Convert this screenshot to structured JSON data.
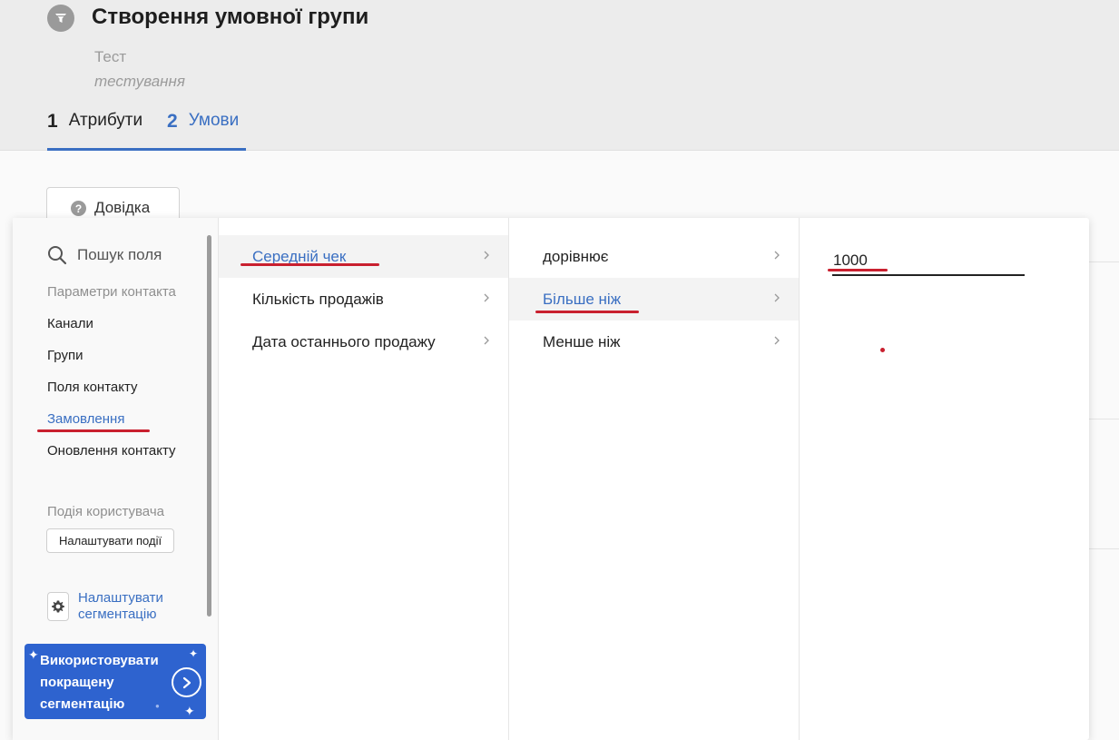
{
  "header": {
    "title": "Створення умовної групи",
    "subtitle": "Тест",
    "description": "тестування",
    "icon": "funnel-icon",
    "steps": [
      {
        "number": "1",
        "label": "Атрибути"
      },
      {
        "number": "2",
        "label": "Умови"
      }
    ]
  },
  "help_button": {
    "label": "Довідка",
    "icon": "help-circle-icon"
  },
  "fields_menu": {
    "search_placeholder": "Пошук поля",
    "contact_section_label": "Параметри контакта",
    "items": [
      "Канали",
      "Групи",
      "Поля контакту",
      "Замовлення",
      "Оновлення контакту"
    ],
    "active_item": "Замовлення",
    "events_section_label": "Подія користувача",
    "configure_events_label": "Налаштувати події",
    "configure_segmentation_label": "Налаштувати сегментацію",
    "promo_label": "Використовувати покращену сегментацію"
  },
  "order_fields": {
    "items": [
      "Середній чек",
      "Кількість продажів",
      "Дата останнього продажу"
    ],
    "selected": "Середній чек"
  },
  "operators": {
    "items": [
      "дорівнює",
      "Більше ніж",
      "Менше ніж"
    ],
    "selected": "Більше ніж"
  },
  "value_input": {
    "value": "1000"
  },
  "colors": {
    "accent": "#3a6fc2",
    "promo_bg": "#2e63cf",
    "annotation_red": "#c9202f"
  }
}
